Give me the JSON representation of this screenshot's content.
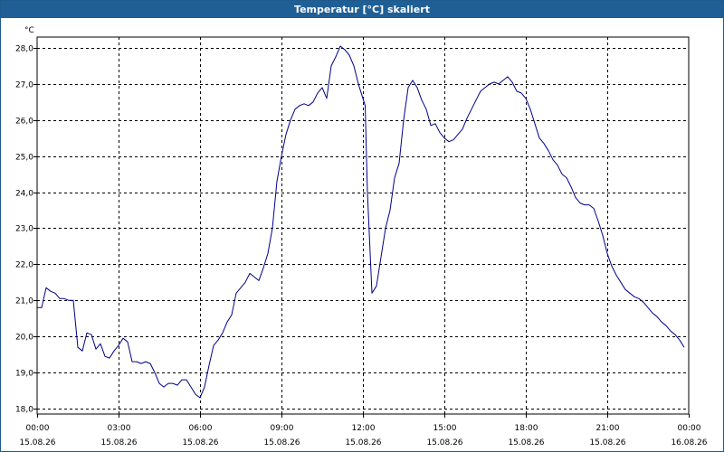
{
  "window": {
    "title": "Temperatur [°C] skaliert"
  },
  "chart_data": {
    "type": "line",
    "title": "Temperatur [°C] skaliert",
    "xlabel": "",
    "ylabel": "°C",
    "ylim": [
      17.85,
      28.3
    ],
    "grid": true,
    "line_color": "#00008b",
    "grid_color": "#000000",
    "y_ticks": [
      "18,0",
      "19,0",
      "20,0",
      "21,0",
      "22,0",
      "23,0",
      "24,0",
      "25,0",
      "26,0",
      "27,0",
      "28,0"
    ],
    "x_ticks": [
      {
        "time": "00:00",
        "date": "15.08.26"
      },
      {
        "time": "03:00",
        "date": "15.08.26"
      },
      {
        "time": "06:00",
        "date": "15.08.26"
      },
      {
        "time": "09:00",
        "date": "15.08.26"
      },
      {
        "time": "12:00",
        "date": "15.08.26"
      },
      {
        "time": "15:00",
        "date": "15.08.26"
      },
      {
        "time": "18:00",
        "date": "15.08.26"
      },
      {
        "time": "21:00",
        "date": "15.08.26"
      },
      {
        "time": "00:00",
        "date": "16.08.26"
      }
    ],
    "series": [
      {
        "points": [
          [
            "00:00",
            20.8
          ],
          [
            "00:10",
            20.8
          ],
          [
            "00:20",
            21.35
          ],
          [
            "00:30",
            21.25
          ],
          [
            "00:40",
            21.2
          ],
          [
            "00:50",
            21.05
          ],
          [
            "01:00",
            21.05
          ],
          [
            "01:10",
            21.0
          ],
          [
            "01:20",
            21.0
          ],
          [
            "01:30",
            19.7
          ],
          [
            "01:40",
            19.6
          ],
          [
            "01:50",
            20.1
          ],
          [
            "02:00",
            20.05
          ],
          [
            "02:10",
            19.65
          ],
          [
            "02:20",
            19.8
          ],
          [
            "02:30",
            19.45
          ],
          [
            "02:40",
            19.4
          ],
          [
            "02:50",
            19.6
          ],
          [
            "03:00",
            19.75
          ],
          [
            "03:10",
            19.95
          ],
          [
            "03:20",
            19.85
          ],
          [
            "03:30",
            19.3
          ],
          [
            "03:40",
            19.3
          ],
          [
            "03:50",
            19.25
          ],
          [
            "04:00",
            19.3
          ],
          [
            "04:10",
            19.25
          ],
          [
            "04:20",
            19.0
          ],
          [
            "04:30",
            18.7
          ],
          [
            "04:40",
            18.6
          ],
          [
            "04:50",
            18.7
          ],
          [
            "05:00",
            18.7
          ],
          [
            "05:10",
            18.65
          ],
          [
            "05:20",
            18.8
          ],
          [
            "05:30",
            18.8
          ],
          [
            "05:40",
            18.6
          ],
          [
            "05:50",
            18.4
          ],
          [
            "06:00",
            18.3
          ],
          [
            "06:10",
            18.6
          ],
          [
            "06:20",
            19.2
          ],
          [
            "06:30",
            19.75
          ],
          [
            "06:40",
            19.9
          ],
          [
            "06:50",
            20.1
          ],
          [
            "07:00",
            20.4
          ],
          [
            "07:10",
            20.6
          ],
          [
            "07:20",
            21.2
          ],
          [
            "07:30",
            21.35
          ],
          [
            "07:40",
            21.5
          ],
          [
            "07:50",
            21.75
          ],
          [
            "08:00",
            21.65
          ],
          [
            "08:10",
            21.55
          ],
          [
            "08:20",
            21.9
          ],
          [
            "08:30",
            22.3
          ],
          [
            "08:40",
            23.0
          ],
          [
            "08:50",
            24.3
          ],
          [
            "09:00",
            25.0
          ],
          [
            "09:10",
            25.6
          ],
          [
            "09:20",
            26.0
          ],
          [
            "09:30",
            26.3
          ],
          [
            "09:40",
            26.4
          ],
          [
            "09:50",
            26.45
          ],
          [
            "10:00",
            26.4
          ],
          [
            "10:10",
            26.5
          ],
          [
            "10:20",
            26.75
          ],
          [
            "10:30",
            26.9
          ],
          [
            "10:40",
            26.6
          ],
          [
            "10:50",
            27.5
          ],
          [
            "11:00",
            27.75
          ],
          [
            "11:10",
            28.05
          ],
          [
            "11:20",
            27.95
          ],
          [
            "11:30",
            27.8
          ],
          [
            "11:40",
            27.5
          ],
          [
            "11:50",
            27.0
          ],
          [
            "12:00",
            26.6
          ],
          [
            "12:05",
            26.4
          ],
          [
            "12:10",
            24.0
          ],
          [
            "12:20",
            21.2
          ],
          [
            "12:30",
            21.4
          ],
          [
            "12:40",
            22.2
          ],
          [
            "12:50",
            23.0
          ],
          [
            "13:00",
            23.5
          ],
          [
            "13:10",
            24.4
          ],
          [
            "13:20",
            24.8
          ],
          [
            "13:30",
            26.0
          ],
          [
            "13:40",
            26.9
          ],
          [
            "13:50",
            27.1
          ],
          [
            "14:00",
            26.9
          ],
          [
            "14:10",
            26.55
          ],
          [
            "14:20",
            26.3
          ],
          [
            "14:30",
            25.85
          ],
          [
            "14:40",
            25.9
          ],
          [
            "14:50",
            25.65
          ],
          [
            "15:00",
            25.5
          ],
          [
            "15:10",
            25.4
          ],
          [
            "15:20",
            25.45
          ],
          [
            "15:30",
            25.6
          ],
          [
            "15:40",
            25.75
          ],
          [
            "15:50",
            26.05
          ],
          [
            "16:00",
            26.3
          ],
          [
            "16:10",
            26.55
          ],
          [
            "16:20",
            26.8
          ],
          [
            "16:30",
            26.9
          ],
          [
            "16:40",
            27.0
          ],
          [
            "16:50",
            27.05
          ],
          [
            "17:00",
            27.0
          ],
          [
            "17:10",
            27.1
          ],
          [
            "17:20",
            27.2
          ],
          [
            "17:30",
            27.05
          ],
          [
            "17:40",
            26.8
          ],
          [
            "17:50",
            26.75
          ],
          [
            "18:00",
            26.6
          ],
          [
            "18:10",
            26.3
          ],
          [
            "18:20",
            25.9
          ],
          [
            "18:30",
            25.5
          ],
          [
            "18:40",
            25.35
          ],
          [
            "18:50",
            25.15
          ],
          [
            "19:00",
            24.9
          ],
          [
            "19:10",
            24.75
          ],
          [
            "19:20",
            24.5
          ],
          [
            "19:30",
            24.4
          ],
          [
            "19:40",
            24.15
          ],
          [
            "19:50",
            23.85
          ],
          [
            "20:00",
            23.7
          ],
          [
            "20:10",
            23.65
          ],
          [
            "20:20",
            23.65
          ],
          [
            "20:30",
            23.55
          ],
          [
            "20:40",
            23.2
          ],
          [
            "20:50",
            22.8
          ],
          [
            "21:00",
            22.3
          ],
          [
            "21:10",
            21.95
          ],
          [
            "21:20",
            21.7
          ],
          [
            "21:30",
            21.5
          ],
          [
            "21:40",
            21.3
          ],
          [
            "21:50",
            21.2
          ],
          [
            "22:00",
            21.1
          ],
          [
            "22:10",
            21.05
          ],
          [
            "22:20",
            20.95
          ],
          [
            "22:30",
            20.8
          ],
          [
            "22:40",
            20.65
          ],
          [
            "22:50",
            20.55
          ],
          [
            "23:00",
            20.4
          ],
          [
            "23:10",
            20.3
          ],
          [
            "23:20",
            20.15
          ],
          [
            "23:30",
            20.05
          ],
          [
            "23:40",
            19.9
          ],
          [
            "23:50",
            19.7
          ]
        ]
      }
    ]
  }
}
